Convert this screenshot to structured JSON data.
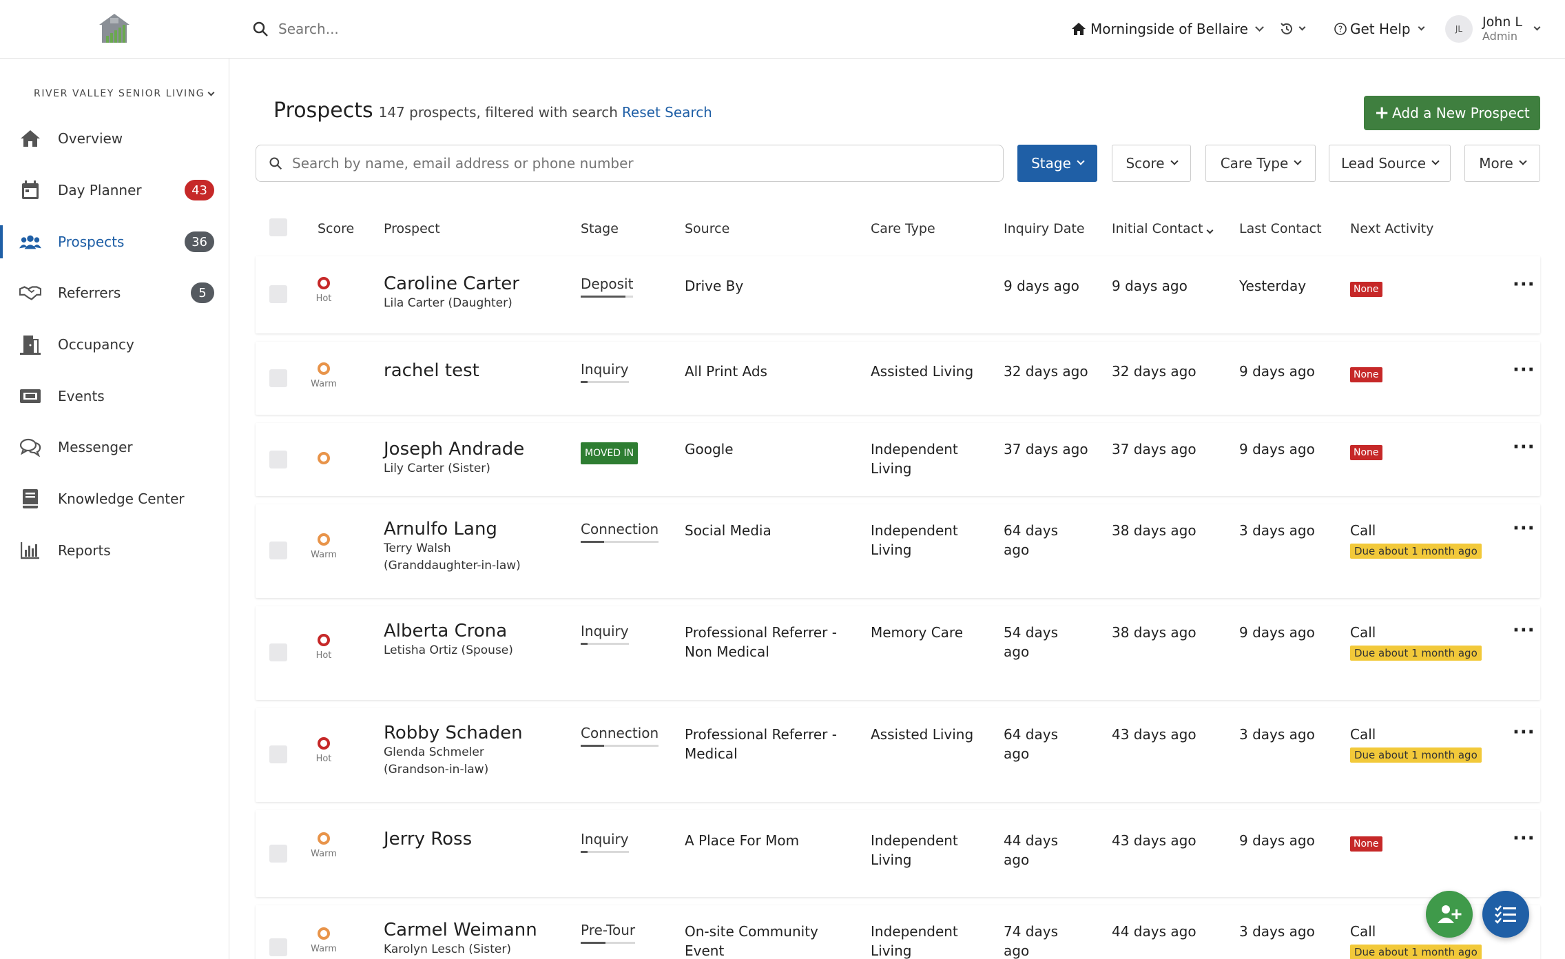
{
  "topbar": {
    "search_placeholder": "Search...",
    "community": "Morningside of Bellaire",
    "get_help": "Get Help",
    "user_initials": "JL",
    "user_name": "John L",
    "user_role": "Admin"
  },
  "sidebar": {
    "org": "RIVER VALLEY SENIOR LIVING",
    "items": [
      {
        "label": "Overview",
        "icon": "home-icon",
        "badge": ""
      },
      {
        "label": "Day Planner",
        "icon": "calendar-icon",
        "badge": "43"
      },
      {
        "label": "Prospects",
        "icon": "users-icon",
        "badge": "36"
      },
      {
        "label": "Referrers",
        "icon": "handshake-icon",
        "badge": "5"
      },
      {
        "label": "Occupancy",
        "icon": "door-icon",
        "badge": ""
      },
      {
        "label": "Events",
        "icon": "ticket-icon",
        "badge": ""
      },
      {
        "label": "Messenger",
        "icon": "chat-icon",
        "badge": ""
      },
      {
        "label": "Knowledge Center",
        "icon": "book-icon",
        "badge": ""
      },
      {
        "label": "Reports",
        "icon": "bar-chart-icon",
        "badge": ""
      }
    ]
  },
  "main": {
    "title": "Prospects",
    "subtitle": "147 prospects, filtered with search",
    "reset_link": "Reset Search",
    "add_button": "Add a New Prospect",
    "search_placeholder": "Search by name, email address or phone number",
    "filters": [
      "Stage",
      "Score",
      "Care Type",
      "Lead Source",
      "More"
    ],
    "columns": {
      "score": "Score",
      "prospect": "Prospect",
      "stage": "Stage",
      "source": "Source",
      "care_type": "Care Type",
      "inquiry_date": "Inquiry Date",
      "initial_contact": "Initial Contact",
      "last_contact": "Last Contact",
      "next_activity": "Next Activity"
    },
    "rows": [
      {
        "score": "Hot",
        "name": "Caroline Carter",
        "contact": "Lila Carter (Daughter)",
        "stage": "Deposit",
        "stage_progress": 0.85,
        "source": "Drive By",
        "care_type": "",
        "inquiry": "9 days ago",
        "initial": "9 days ago",
        "last": "Yesterday",
        "activity": "",
        "activity_badge": "None"
      },
      {
        "score": "Warm",
        "name": "rachel test",
        "contact": "",
        "stage": "Inquiry",
        "stage_progress": 0.15,
        "source": "All Print Ads",
        "care_type": "Assisted Living",
        "inquiry": "32 days ago",
        "initial": "32 days ago",
        "last": "9 days ago",
        "activity": "",
        "activity_badge": "None"
      },
      {
        "score": "",
        "name": "Joseph Andrade",
        "contact": "Lily Carter (Sister)",
        "stage": "MOVED IN",
        "stage_progress": 1,
        "source": "Google",
        "care_type": "Independent Living",
        "inquiry": "37 days ago",
        "initial": "37 days ago",
        "last": "9 days ago",
        "activity": "",
        "activity_badge": "None"
      },
      {
        "score": "Warm",
        "name": "Arnulfo Lang",
        "contact": "Terry Walsh (Granddaughter-in-law)",
        "stage": "Connection",
        "stage_progress": 0.3,
        "source": "Social Media",
        "care_type": "Independent Living",
        "inquiry": "64 days ago",
        "initial": "38 days ago",
        "last": "3 days ago",
        "activity": "Call",
        "activity_badge": "Due about 1 month ago"
      },
      {
        "score": "Hot",
        "name": "Alberta Crona",
        "contact": "Letisha Ortiz (Spouse)",
        "stage": "Inquiry",
        "stage_progress": 0.15,
        "source": "Professional Referrer - Non Medical",
        "care_type": "Memory Care",
        "inquiry": "54 days ago",
        "initial": "38 days ago",
        "last": "9 days ago",
        "activity": "Call",
        "activity_badge": "Due about 1 month ago"
      },
      {
        "score": "Hot",
        "name": "Robby Schaden",
        "contact": "Glenda Schmeler (Grandson-in-law)",
        "stage": "Connection",
        "stage_progress": 0.3,
        "source": "Professional Referrer - Medical",
        "care_type": "Assisted Living",
        "inquiry": "64 days ago",
        "initial": "43 days ago",
        "last": "3 days ago",
        "activity": "Call",
        "activity_badge": "Due about 1 month ago"
      },
      {
        "score": "Warm",
        "name": "Jerry Ross",
        "contact": "",
        "stage": "Inquiry",
        "stage_progress": 0.15,
        "source": "A Place For Mom",
        "care_type": "Independent Living",
        "inquiry": "44 days ago",
        "initial": "43 days ago",
        "last": "9 days ago",
        "activity": "",
        "activity_badge": "None"
      },
      {
        "score": "Warm",
        "name": "Carmel Weimann",
        "contact": "Karolyn Lesch (Sister)",
        "stage": "Pre-Tour",
        "stage_progress": 0.45,
        "source": "On-site Community Event",
        "care_type": "Independent Living",
        "inquiry": "74 days ago",
        "initial": "44 days ago",
        "last": "3 days ago",
        "activity": "Call",
        "activity_badge": "Due about 1 month ago"
      }
    ]
  },
  "colors": {
    "primary": "#1f5fa6",
    "success": "#3f7f3f",
    "hot": "#c62828",
    "warm": "#e8944a",
    "due": "#f2c93a"
  }
}
